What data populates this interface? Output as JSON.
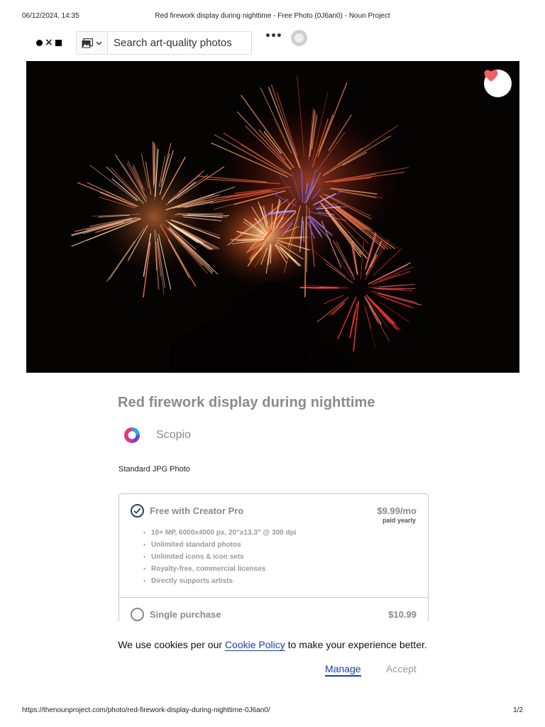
{
  "print": {
    "datetime": "06/12/2024, 14:35",
    "page_title": "Red firework display during nighttime - Free Photo (0J6an0) - Noun Project",
    "url": "https://thenounproject.com/photo/red-firework-display-during-nighttime-0J6an0/",
    "page_number": "1/2"
  },
  "nav": {
    "logo": "noun-project-logo",
    "type_select_icon": "photo-icon",
    "search_placeholder": "Search art-quality photos",
    "more_icon": "ellipsis-icon",
    "avatar_icon": "user-avatar"
  },
  "hero": {
    "favorite_icon": "heart-icon",
    "favorite_color": "#f06060"
  },
  "photo": {
    "title": "Red firework display during nighttime",
    "creator": "Scopio",
    "format": "Standard JPG Photo"
  },
  "licenses": {
    "pro": {
      "label": "Free with Creator Pro",
      "price": "$9.99/mo",
      "price_note": "paid yearly",
      "selected": true,
      "features": [
        "10+ MP, 6000x4000 px, 20\"x13.3\" @ 300 dpi",
        "Unlimited standard photos",
        "Unlimited icons & icon sets",
        "Royalty-free, commercial licenses",
        "Directly supports artists"
      ]
    },
    "single": {
      "label": "Single purchase",
      "price": "$10.99",
      "selected": false
    }
  },
  "cookies": {
    "text_before": "We use cookies per our ",
    "link": "Cookie Policy",
    "text_after": " to make your experience better.",
    "manage": "Manage",
    "accept": "Accept",
    "accent_color": "#1a3ea8"
  }
}
